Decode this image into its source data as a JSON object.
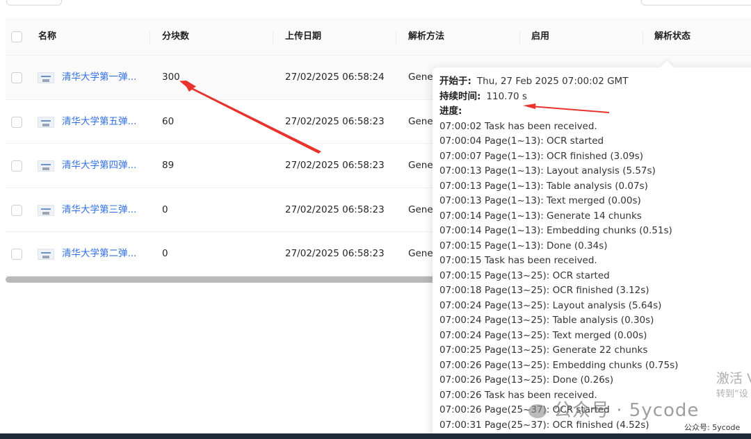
{
  "table": {
    "columns": [
      "名称",
      "分块数",
      "上传日期",
      "解析方法",
      "启用",
      "解析状态"
    ],
    "rows": [
      {
        "name": "清华大学第一弹...",
        "chunks": "300",
        "date": "27/02/2025 06:58:24",
        "method": "Gene"
      },
      {
        "name": "清华大学第五弹...",
        "chunks": "60",
        "date": "27/02/2025 06:58:23",
        "method": "Gene"
      },
      {
        "name": "清华大学第四弹...",
        "chunks": "89",
        "date": "27/02/2025 06:58:23",
        "method": "Gene"
      },
      {
        "name": "清华大学第三弹...",
        "chunks": "0",
        "date": "27/02/2025 06:58:23",
        "method": "Gene"
      },
      {
        "name": "清华大学第二弹...",
        "chunks": "0",
        "date": "27/02/2025 06:58:23",
        "method": "Gene"
      }
    ]
  },
  "tooltip": {
    "start_label": "开始于:",
    "start_value": "Thu, 27 Feb 2025 07:00:02 GMT",
    "duration_label": "持续时间:",
    "duration_value": "110.70 s",
    "progress_label": "进度:",
    "log": [
      "07:00:02 Task has been received.",
      "07:00:04 Page(1~13): OCR started",
      "07:00:07 Page(1~13): OCR finished (3.09s)",
      "07:00:13 Page(1~13): Layout analysis (5.57s)",
      "07:00:13 Page(1~13): Table analysis (0.07s)",
      "07:00:13 Page(1~13): Text merged (0.00s)",
      "07:00:14 Page(1~13): Generate 14 chunks",
      "07:00:14 Page(1~13): Embedding chunks (0.51s)",
      "07:00:15 Page(1~13): Done (0.34s)",
      "07:00:15 Task has been received.",
      "07:00:15 Page(13~25): OCR started",
      "07:00:18 Page(13~25): OCR finished (3.12s)",
      "07:00:24 Page(13~25): Layout analysis (5.64s)",
      "07:00:24 Page(13~25): Table analysis (0.30s)",
      "07:00:24 Page(13~25): Text merged (0.00s)",
      "07:00:25 Page(13~25): Generate 22 chunks",
      "07:00:26 Page(13~25): Embedding chunks (0.75s)",
      "07:00:26 Page(13~25): Done (0.26s)",
      "07:00:26 Task has been received.",
      "07:00:26 Page(25~37): OCR started",
      "07:00:31 Page(25~37): OCR finished (4.52s)"
    ]
  },
  "watermarks": {
    "activate": "激活 V",
    "goto": "转到“设",
    "wechat": "公众号 · 5ycode",
    "small": "公众号: 5ycode"
  },
  "colors": {
    "link": "#2f6fe4",
    "annotation_arrow": "#e8322b"
  }
}
